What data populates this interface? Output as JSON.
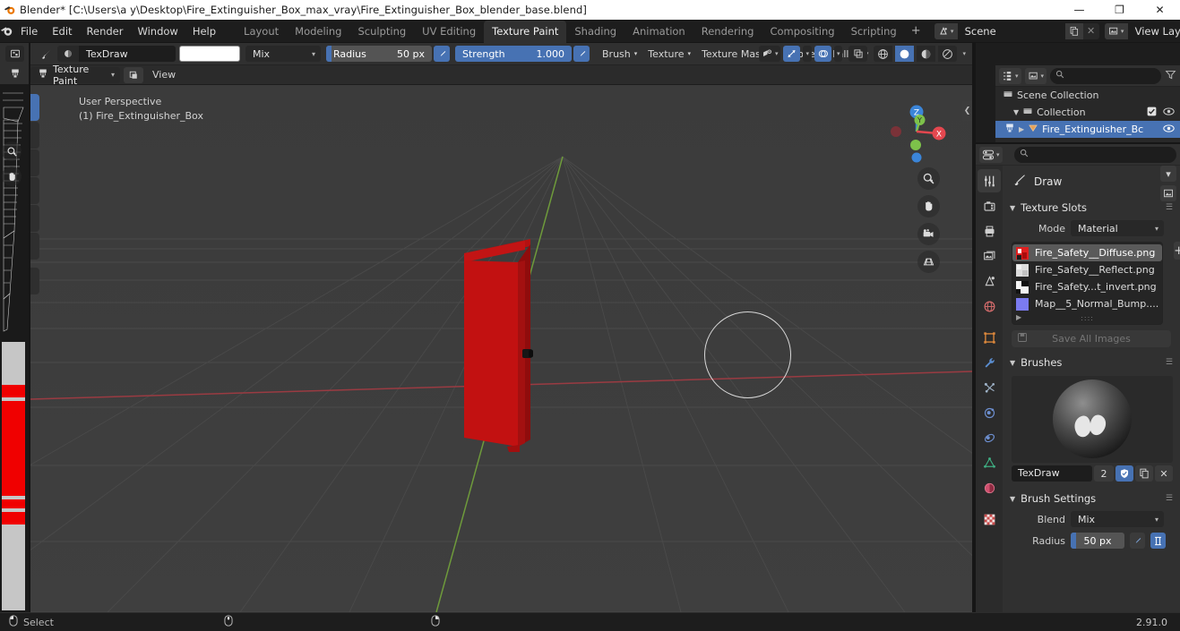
{
  "window": {
    "title": "Blender* [C:\\Users\\a y\\Desktop\\Fire_Extinguisher_Box_max_vray\\Fire_Extinguisher_Box_blender_base.blend]",
    "app_icon": "blender-logo-icon",
    "minimize": "—",
    "maximize": "❐",
    "close": "✕"
  },
  "menus": [
    {
      "label": "File"
    },
    {
      "label": "Edit"
    },
    {
      "label": "Render"
    },
    {
      "label": "Window"
    },
    {
      "label": "Help"
    }
  ],
  "workspace_tabs": [
    {
      "label": "Layout",
      "active": false
    },
    {
      "label": "Modeling",
      "active": false
    },
    {
      "label": "Sculpting",
      "active": false
    },
    {
      "label": "UV Editing",
      "active": false
    },
    {
      "label": "Texture Paint",
      "active": true
    },
    {
      "label": "Shading",
      "active": false
    },
    {
      "label": "Animation",
      "active": false
    },
    {
      "label": "Rendering",
      "active": false
    },
    {
      "label": "Compositing",
      "active": false
    },
    {
      "label": "Scripting",
      "active": false
    }
  ],
  "workspace_add": "+",
  "scene": {
    "icon": "scene-icon",
    "name": "Scene",
    "new_button": "new-scene-icon",
    "unlink_button": "✕"
  },
  "view_layer": {
    "icon": "view-layer-icon",
    "name": "View Layer",
    "new_button": "new-view-layer-icon",
    "unlink_button": "✕"
  },
  "viewport_header": {
    "editor_type_icon": "editor-type-3dview-icon",
    "brush_icon": "brush-icon",
    "texture_icon": "brush-texture-icon",
    "brush_name": "TexDraw",
    "color_swatch": "#ffffff",
    "blend_mode": "Mix",
    "radius_label": "Radius",
    "radius_value": "50 px",
    "radius_pressure_icon": "pressure-icon",
    "strength_label": "Strength",
    "strength_value": "1.000",
    "strength_pressure_icon": "pressure-icon",
    "menus": [
      {
        "label": "Brush"
      },
      {
        "label": "Texture"
      },
      {
        "label": "Texture Mask"
      },
      {
        "label": "Stroke"
      },
      {
        "label": "Falloff"
      }
    ],
    "overlays": [
      {
        "name": "object-type-visibility-icon"
      },
      {
        "name": "gizmo-icon"
      },
      {
        "name": "overlays-icon"
      },
      {
        "name": "xray-toggle-icon"
      },
      {
        "name": "shading-wireframe-icon"
      },
      {
        "name": "shading-solid-icon"
      },
      {
        "name": "shading-material-icon"
      },
      {
        "name": "shading-rendered-icon"
      }
    ]
  },
  "tool_header": {
    "mode_icon": "texture-paint-mode-icon",
    "mode": "Texture Paint",
    "tool_settings_icon": "tool-settings-icon",
    "view_menu": "View"
  },
  "viewport": {
    "perspective_label": "User Perspective",
    "object_label": "(1) Fire_Extinguisher_Box",
    "gizmo_axes": [
      {
        "label": "Z",
        "color": "#3b85d8"
      },
      {
        "label": "Y",
        "color": "#7dc14a"
      },
      {
        "label": "X",
        "color": "#e4474f"
      }
    ],
    "nav_buttons": [
      {
        "name": "zoom-icon"
      },
      {
        "name": "pan-hand-icon"
      },
      {
        "name": "camera-view-icon"
      },
      {
        "name": "toggle-perspective-icon"
      }
    ],
    "brush_cursor": {
      "name": "brush-cursor-circle",
      "radius_px": "50 px"
    },
    "model_color": "#c01111"
  },
  "toolbar": {
    "tools": [
      {
        "name": "tool-draw",
        "icon": "brush-icon",
        "active": true
      },
      {
        "name": "tool-soften",
        "icon": "droplet-icon",
        "active": false
      },
      {
        "name": "tool-smear",
        "icon": "smear-icon",
        "active": false
      },
      {
        "name": "tool-clone",
        "icon": "stamp-icon",
        "active": false
      },
      {
        "name": "tool-fill",
        "icon": "paint-bucket-icon",
        "active": false
      },
      {
        "name": "tool-mask",
        "icon": "mask-icon",
        "active": false
      },
      {
        "name": "tool-annotate",
        "icon": "annotate-pencil-icon",
        "active": false
      }
    ]
  },
  "left_image_editor": {
    "editor_type_icon": "image-editor-icon",
    "mode_icon": "texture-paint-mode-icon",
    "zoom_icon": "zoom-icon",
    "pan_icon": "pan-hand-icon"
  },
  "outliner": {
    "display_mode_icon": "outliner-display-mode-icon",
    "filter_id_icon": "filter-id-icon",
    "search_placeholder": "",
    "search_value": "",
    "filter_icon": "filter-funnel-icon",
    "rows": [
      {
        "label": "Scene Collection",
        "icon": "collection-icon",
        "indent": 0,
        "selected": false,
        "expandable": false,
        "checkbox": false,
        "eye": false
      },
      {
        "label": "Collection",
        "icon": "collection-icon",
        "indent": 1,
        "selected": false,
        "expandable": true,
        "checkbox": true,
        "eye": true
      },
      {
        "label": "Fire_Extinguisher_Bc",
        "icon": "mesh-object-icon",
        "indent": 2,
        "selected": true,
        "expandable": true,
        "checkbox": false,
        "eye": true
      }
    ]
  },
  "properties": {
    "editor_type_icon": "properties-editor-icon",
    "search_placeholder": "",
    "search_value": "",
    "tabs": [
      {
        "name": "tool-tab",
        "icon": "tool-icon",
        "active": true,
        "color": "#c8c8c8"
      },
      {
        "name": "render-tab",
        "icon": "camera-back-icon",
        "active": false,
        "color": "#c8c8c8"
      },
      {
        "name": "output-tab",
        "icon": "printer-icon",
        "active": false,
        "color": "#c8c8c8"
      },
      {
        "name": "view-layer-tab",
        "icon": "images-icon",
        "active": false,
        "color": "#c8c8c8"
      },
      {
        "name": "scene-tab",
        "icon": "scene-cone-icon",
        "active": false,
        "color": "#c8c8c8"
      },
      {
        "name": "world-tab",
        "icon": "world-icon",
        "active": false,
        "color": "#d06a6a"
      },
      {
        "name": "object-tab",
        "icon": "object-square-icon",
        "active": false,
        "color": "#e08a3c"
      },
      {
        "name": "modifier-tab",
        "icon": "wrench-icon",
        "active": false,
        "color": "#5b8ed0"
      },
      {
        "name": "particles-tab",
        "icon": "particles-icon",
        "active": false,
        "color": "#9fb3c8"
      },
      {
        "name": "physics-tab",
        "icon": "physics-orbit-icon",
        "active": false,
        "color": "#6d8fd0"
      },
      {
        "name": "constraints-tab",
        "icon": "constraint-icon",
        "active": false,
        "color": "#6d8fd0"
      },
      {
        "name": "data-tab",
        "icon": "mesh-data-triangle-icon",
        "active": false,
        "color": "#3fae82"
      },
      {
        "name": "material-tab",
        "icon": "material-sphere-icon",
        "active": false,
        "color": "#d04f6e"
      },
      {
        "name": "texture-tab",
        "icon": "texture-checker-icon",
        "active": false,
        "color": "#d05a5a"
      }
    ],
    "tool_title": "Draw",
    "tool_title_icon": "brush-icon",
    "panels": {
      "texture_slots": {
        "title": "Texture Slots",
        "mode_label": "Mode",
        "mode_value": "Material",
        "add_button": "+",
        "slots": [
          {
            "label": "Fire_Safety__Diffuse.png",
            "swatch": "diffuse-thumb",
            "selected": true
          },
          {
            "label": "Fire_Safety__Reflect.png",
            "swatch": "reflect-thumb",
            "selected": false
          },
          {
            "label": "Fire_Safety...t_invert.png",
            "swatch": "invert-thumb",
            "selected": false
          },
          {
            "label": "Map__5_Normal_Bump....",
            "swatch": "normal-thumb",
            "selected": false
          }
        ],
        "save_all_images": "Save All Images",
        "save_icon": "save-disk-icon"
      },
      "brushes": {
        "title": "Brushes",
        "preview_icon": "brush-sphere-preview",
        "browse_icon": "chevron-down-icon",
        "new_icon": "new-image-icon",
        "brush_name": "TexDraw",
        "users_count": "2",
        "fake_user_icon": "shield-icon",
        "duplicate_icon": "copy-icon",
        "unlink_icon": "✕"
      },
      "brush_settings": {
        "title": "Brush Settings",
        "blend_label": "Blend",
        "blend_value": "Mix",
        "radius_label": "Radius",
        "radius_value": "50 px",
        "radius_pressure_icon": "pressure-icon",
        "radius_unit_icon": "unit-scene-icon"
      }
    }
  },
  "status_bar": {
    "items": [
      {
        "icon": "mouse-left-icon",
        "label": "Select"
      },
      {
        "icon": "mouse-middle-icon",
        "label": ""
      },
      {
        "icon": "mouse-right-icon",
        "label": ""
      }
    ],
    "version": "2.91.0"
  }
}
